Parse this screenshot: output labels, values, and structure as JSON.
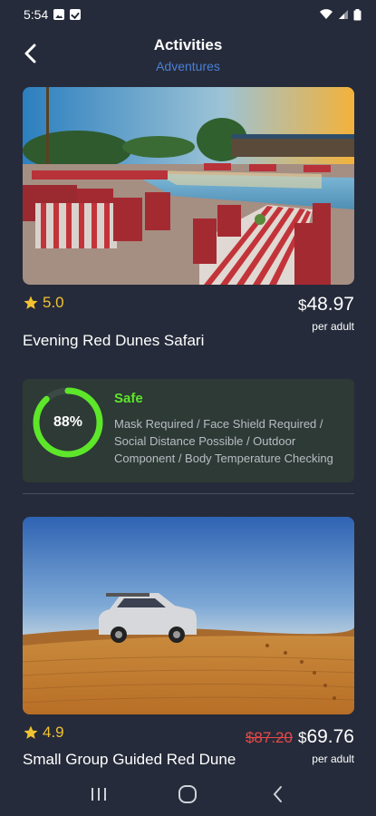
{
  "status": {
    "time": "5:54"
  },
  "header": {
    "title": "Activities",
    "subtitle": "Adventures"
  },
  "activities": [
    {
      "rating": "5.0",
      "price_currency": "$",
      "price": "48.97",
      "old_price": "",
      "price_unit": "per adult",
      "name": "Evening Red Dunes Safari"
    },
    {
      "rating": "4.9",
      "price_currency": "$",
      "price": "69.76",
      "old_price": "$87.20",
      "price_unit": "per adult",
      "name": "Small Group Guided Red Dune"
    }
  ],
  "safety": {
    "percent": "88%",
    "score_fraction": 0.88,
    "label": "Safe",
    "measures": "Mask Required / Face Shield Required / Social Distance Possible / Outdoor Component / Body Temperature Checking",
    "ring_color": "#5de62a"
  },
  "colors": {
    "accent": "#4a7fd6",
    "star": "#f2c230",
    "discount": "#e84848",
    "background": "#252b3a"
  }
}
